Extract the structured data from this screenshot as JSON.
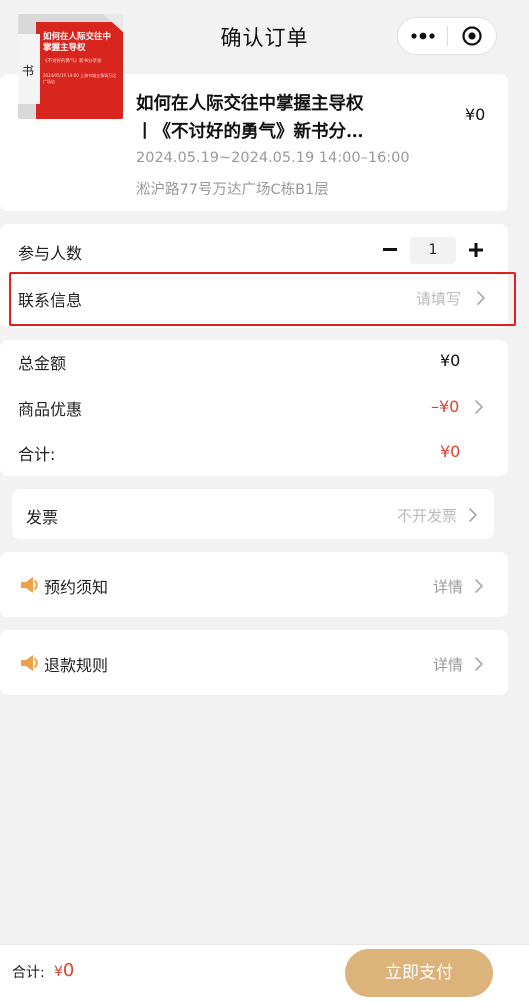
{
  "header": {
    "title": "确认订单"
  },
  "product": {
    "name_line1": "如何在人际交往中掌握主导权",
    "name_line2": "丨《不讨好的勇气》新书分…",
    "price": "¥0",
    "time": "2024.05.19~2024.05.19 14:00–16:00",
    "address": "淞沪路77号万达广场C栋B1层",
    "poster": {
      "title": "如何在人际交往中掌握主导权",
      "subtitle": "《不讨好的勇气》新书分享会",
      "line": "2024/05/19 14:00  上海书城五角场万达广场店"
    }
  },
  "participants": {
    "label": "参与人数",
    "quantity": "1"
  },
  "contact": {
    "label": "联系信息",
    "placeholder": "请填写"
  },
  "totals": {
    "total_label": "总金额",
    "total_value": "¥0",
    "discount_label": "商品优惠",
    "discount_value": "–¥0",
    "sum_label": "合计:",
    "sum_value": "¥0"
  },
  "invoice": {
    "label": "发票",
    "value": "不开发票"
  },
  "notice": {
    "label": "预约须知",
    "detail": "详情"
  },
  "refund": {
    "label": "退款规则",
    "detail": "详情"
  },
  "bottom": {
    "sum_label": "合计:",
    "currency": "¥",
    "amount": "0",
    "pay_label": "立即支付"
  },
  "colors": {
    "accent": "#e0412f",
    "pay_button": "#dcb37a",
    "highlight_border": "#e02020",
    "speaker": "#f0a04b"
  },
  "icons": {
    "back": "chevron-left-icon",
    "more": "more-dots-icon",
    "close": "target-circle-icon",
    "minus": "minus-icon",
    "plus": "plus-icon",
    "chevron": "chevron-right-icon",
    "speaker": "speaker-icon"
  }
}
